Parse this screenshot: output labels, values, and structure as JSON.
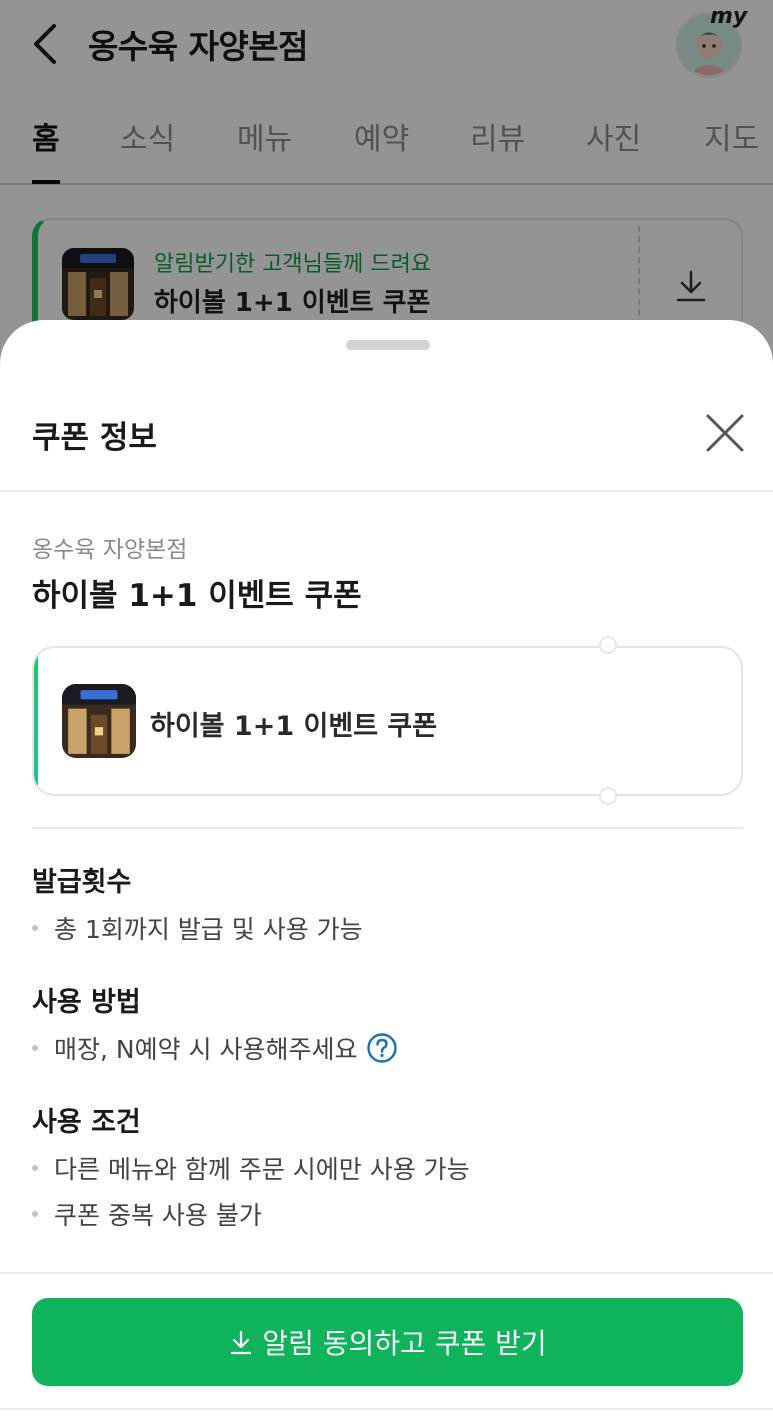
{
  "header": {
    "title": "옹수육 자양본점",
    "my_label": "my"
  },
  "tabs": [
    "홈",
    "소식",
    "메뉴",
    "예약",
    "리뷰",
    "사진",
    "지도"
  ],
  "background_coupon": {
    "subtitle": "알림받기한 고객님들께 드려요",
    "name": "하이볼 1+1 이벤트 쿠폰"
  },
  "sheet": {
    "title": "쿠폰 정보",
    "store": "옹수육 자양본점",
    "coupon_name": "하이볼 1+1 이벤트 쿠폰",
    "card_name": "하이볼 1+1 이벤트 쿠폰",
    "sections": [
      {
        "heading": "발급횟수",
        "items": [
          "총 1회까지 발급 및 사용 가능"
        ]
      },
      {
        "heading": "사용 방법",
        "items": [
          "매장, N예약 시 사용해주세요"
        ]
      },
      {
        "heading": "사용 조건",
        "items": [
          "다른 메뉴와 함께 주문 시에만 사용 가능",
          "쿠폰 중복 사용 불가"
        ]
      }
    ],
    "cta_label": "알림 동의하고 쿠폰 받기"
  },
  "icons": [
    "back-arrow-icon",
    "avatar-icon",
    "download-icon",
    "close-icon",
    "help-question-icon"
  ],
  "colors": {
    "accent_green": "#0fb35c",
    "subtitle_green": "#0f9e4a",
    "help_blue": "#1a6fb8"
  }
}
